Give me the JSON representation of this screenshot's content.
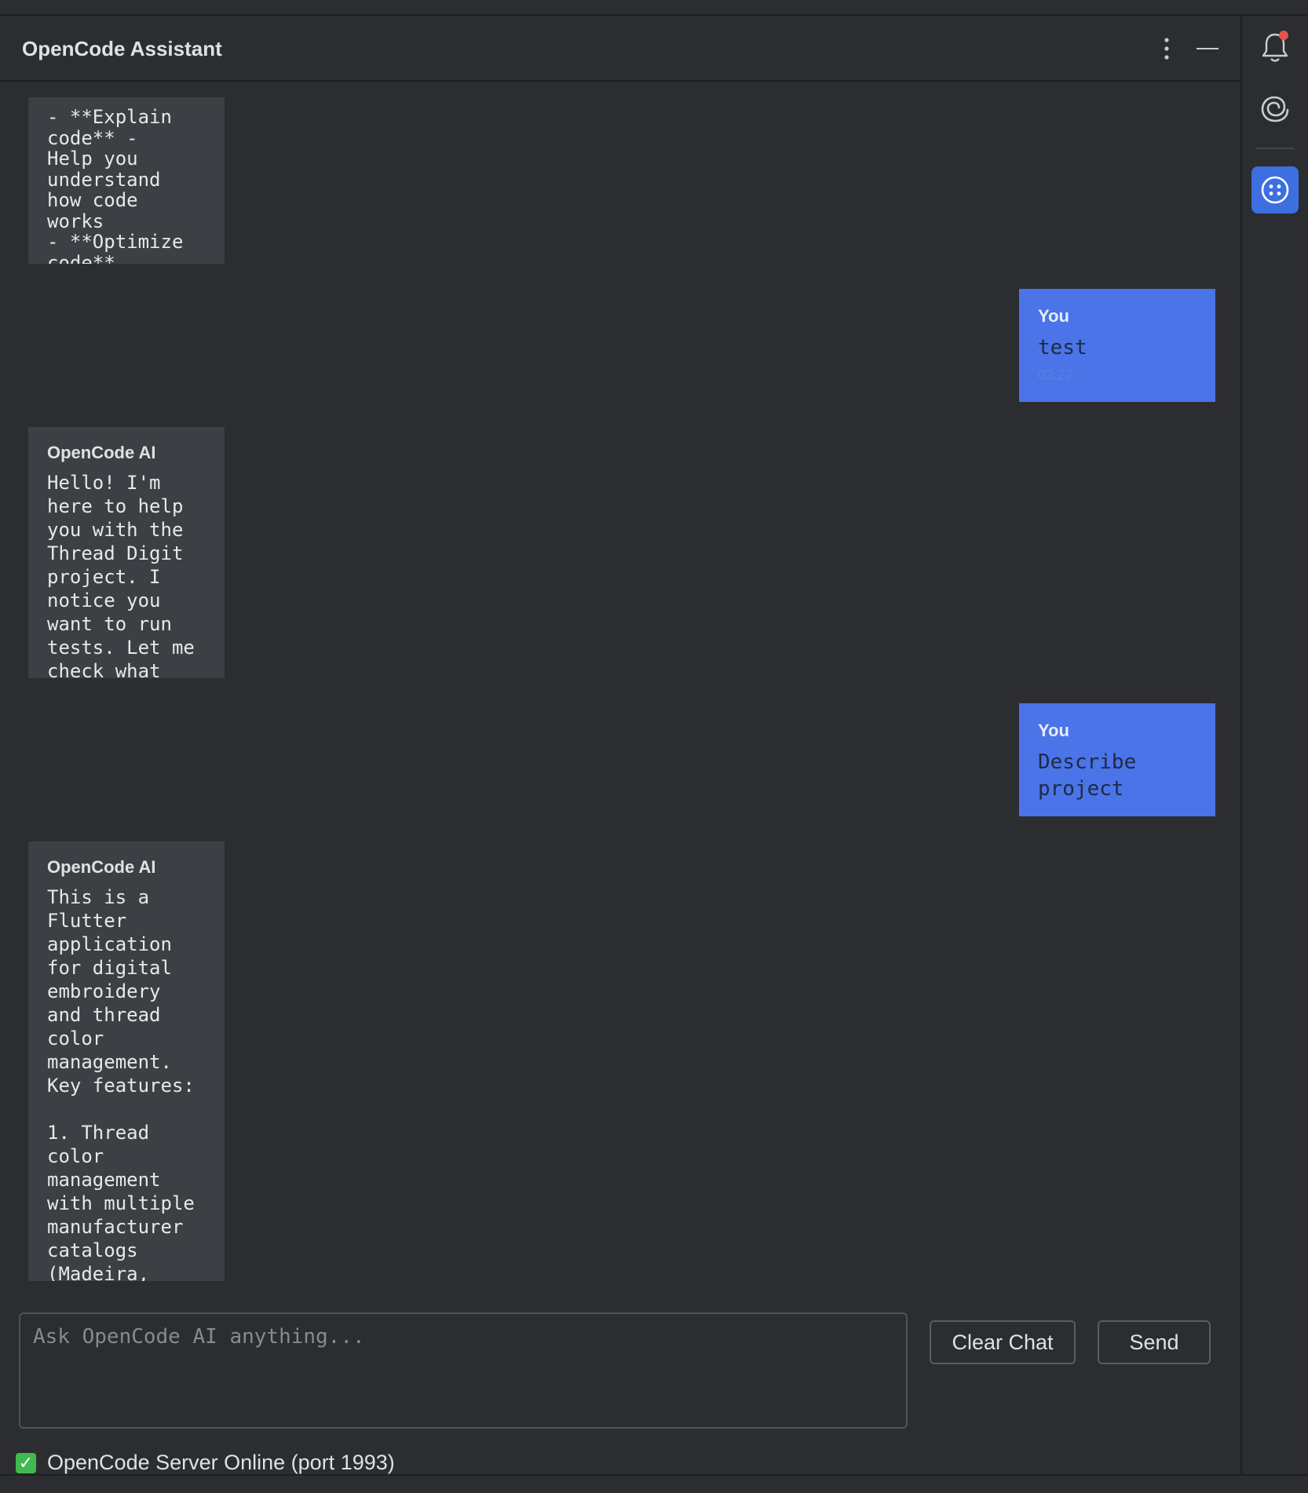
{
  "panel": {
    "title": "OpenCode Assistant"
  },
  "messages": [
    {
      "role": "ai",
      "sender": "",
      "text": "- **Explain code** -\nHelp you understand how code works\n- **Optimize code**"
    },
    {
      "role": "user",
      "sender": "You",
      "text": "test",
      "time": "03:27"
    },
    {
      "role": "ai",
      "sender": "OpenCode AI",
      "text": "Hello! I'm here to help you with the Thread Digit project. I notice you want to run tests. Let me check what"
    },
    {
      "role": "user",
      "sender": "You",
      "text": "Describe project",
      "time": ""
    },
    {
      "role": "ai",
      "sender": "OpenCode AI",
      "text": "This is a Flutter application for digital embroidery and thread color management. Key features:\n\n1. Thread color management with multiple manufacturer catalogs (Madeira,"
    }
  ],
  "input": {
    "placeholder": "Ask OpenCode AI anything..."
  },
  "buttons": {
    "clear": "Clear Chat",
    "send": "Send"
  },
  "status": {
    "text": "OpenCode Server Online (port 1993)",
    "color": "#3fb950"
  },
  "icons": {
    "options": "more-vertical-icon",
    "minimize": "minimize-icon",
    "notifications": "bell-icon",
    "spiral": "spiral-icon",
    "assistant": "assistant-dots-icon"
  },
  "colors": {
    "user_bubble": "#4a74e8",
    "ai_bubble": "#3c3f44",
    "background": "#2b2d30",
    "notification_dot": "#e5534b"
  }
}
